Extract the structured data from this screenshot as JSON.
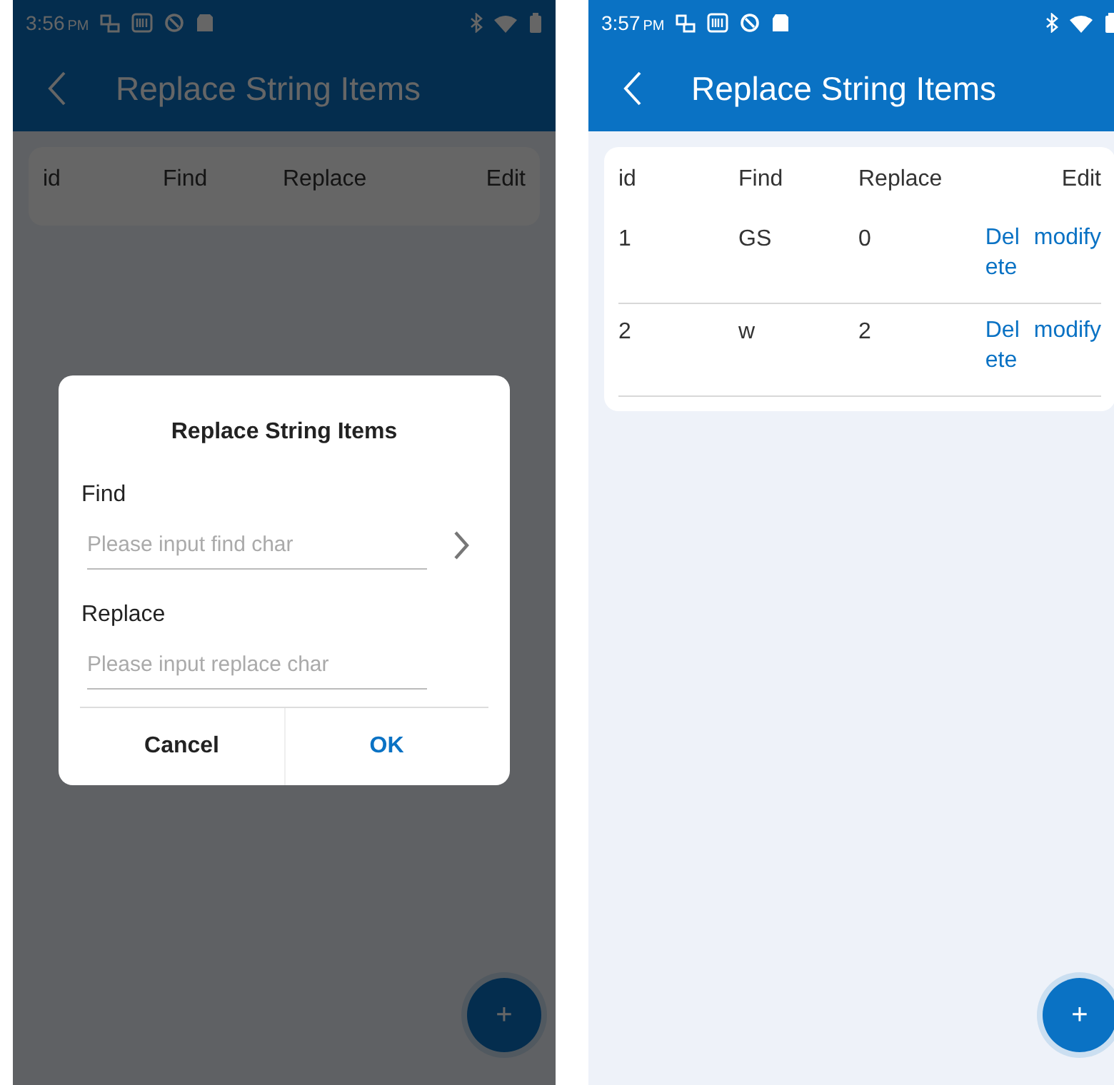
{
  "screens": [
    {
      "status_bar": {
        "time": "3:56",
        "meridiem": "PM"
      },
      "app_bar": {
        "title": "Replace String Items"
      },
      "table": {
        "columns": [
          "id",
          "Find",
          "Replace",
          "Edit"
        ]
      },
      "fab": {
        "label": "+"
      },
      "dialog": {
        "title": "Replace String Items",
        "fields": [
          {
            "label": "Find",
            "placeholder": "Please input find char",
            "kind": "picker"
          },
          {
            "label": "Replace",
            "placeholder": "Please input replace char",
            "kind": "text"
          }
        ],
        "buttons": [
          {
            "label": "Cancel",
            "kind": "cancel"
          },
          {
            "label": "OK",
            "kind": "confirm"
          }
        ]
      }
    },
    {
      "status_bar": {
        "time": "3:57",
        "meridiem": "PM"
      },
      "app_bar": {
        "title": "Replace String Items"
      },
      "table": {
        "columns": [
          "id",
          "Find",
          "Replace",
          "Edit"
        ],
        "rows": [
          {
            "id": "1",
            "find": "GS",
            "replace": "0",
            "actions": [
              "Delete",
              "modify"
            ]
          },
          {
            "id": "2",
            "find": "w",
            "replace": "2",
            "actions": [
              "Delete",
              "modify"
            ]
          }
        ]
      },
      "fab": {
        "label": "+"
      }
    }
  ]
}
